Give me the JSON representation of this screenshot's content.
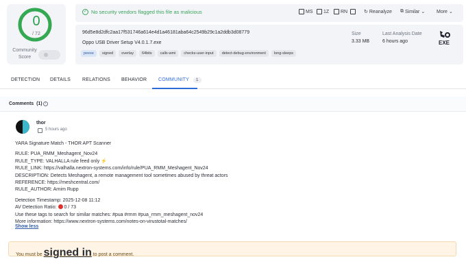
{
  "score": {
    "detections": "0",
    "total": "/ 72",
    "label": "Community Score"
  },
  "topbar": {
    "verdict": "No security vendors flagged this file as malicious",
    "buttons": [
      "MS",
      "1Z",
      "RN",
      "",
      "Reanalyze",
      "Similar",
      "More"
    ]
  },
  "file": {
    "hash": "96d5e8d2dfc2aa17f531746a614e4d1a46181aba64c2549b29c1a2ddb3d08779",
    "name": "Oppo USB Driver Setup V4.0.1.7.exe",
    "tags": [
      "peexe",
      "signed",
      "overlay",
      "64bits",
      "calls-wmi",
      "checks-user-input",
      "detect-debug-environment",
      "long-sleeps"
    ],
    "size_label": "Size",
    "size_value": "3.33 MB",
    "date_label": "Last Analysis Date",
    "date_value": "6 hours ago",
    "type": "EXE"
  },
  "tabs": [
    {
      "label": "DETECTION"
    },
    {
      "label": "DETAILS"
    },
    {
      "label": "RELATIONS"
    },
    {
      "label": "BEHAVIOR"
    },
    {
      "label": "COMMUNITY",
      "count": "1"
    }
  ],
  "comments": {
    "title": "Comments",
    "count": "(1)",
    "author": "thor",
    "time": "5 hours ago",
    "lines": [
      "YARA Signature Match - THOR APT Scanner",
      "",
      "RULE: PUA_RMM_Meshagent_Nov24",
      "RULE_TYPE: VALHALLA rule feed only ⚡",
      "RULE_LINK: https://valhalla.nextron-systems.com/info/rule/PUA_RMM_Meshagent_Nov24",
      "DESCRIPTION: Detects Meshagent, a remote management tool sometimes abused by threat actors",
      "REFERENCE: https://meshcentral.com/",
      "RULE_AUTHOR: Arnim Rupp",
      "",
      "Detection Timestamp: 2025-12-08 11:12",
      "AV Detection Ratio: ",
      "Use these tags to search for similar matches: #pua #rmm #pua_rmm_meshagent_nov24",
      "More information: https://www.nextron-systems.com/notes-on-virustotal-matches/"
    ],
    "ratio_value": " 0 / 73",
    "show_less": "Show less"
  },
  "notice": {
    "before": "You must be ",
    "link": "signed in",
    "after": " to post a comment."
  }
}
